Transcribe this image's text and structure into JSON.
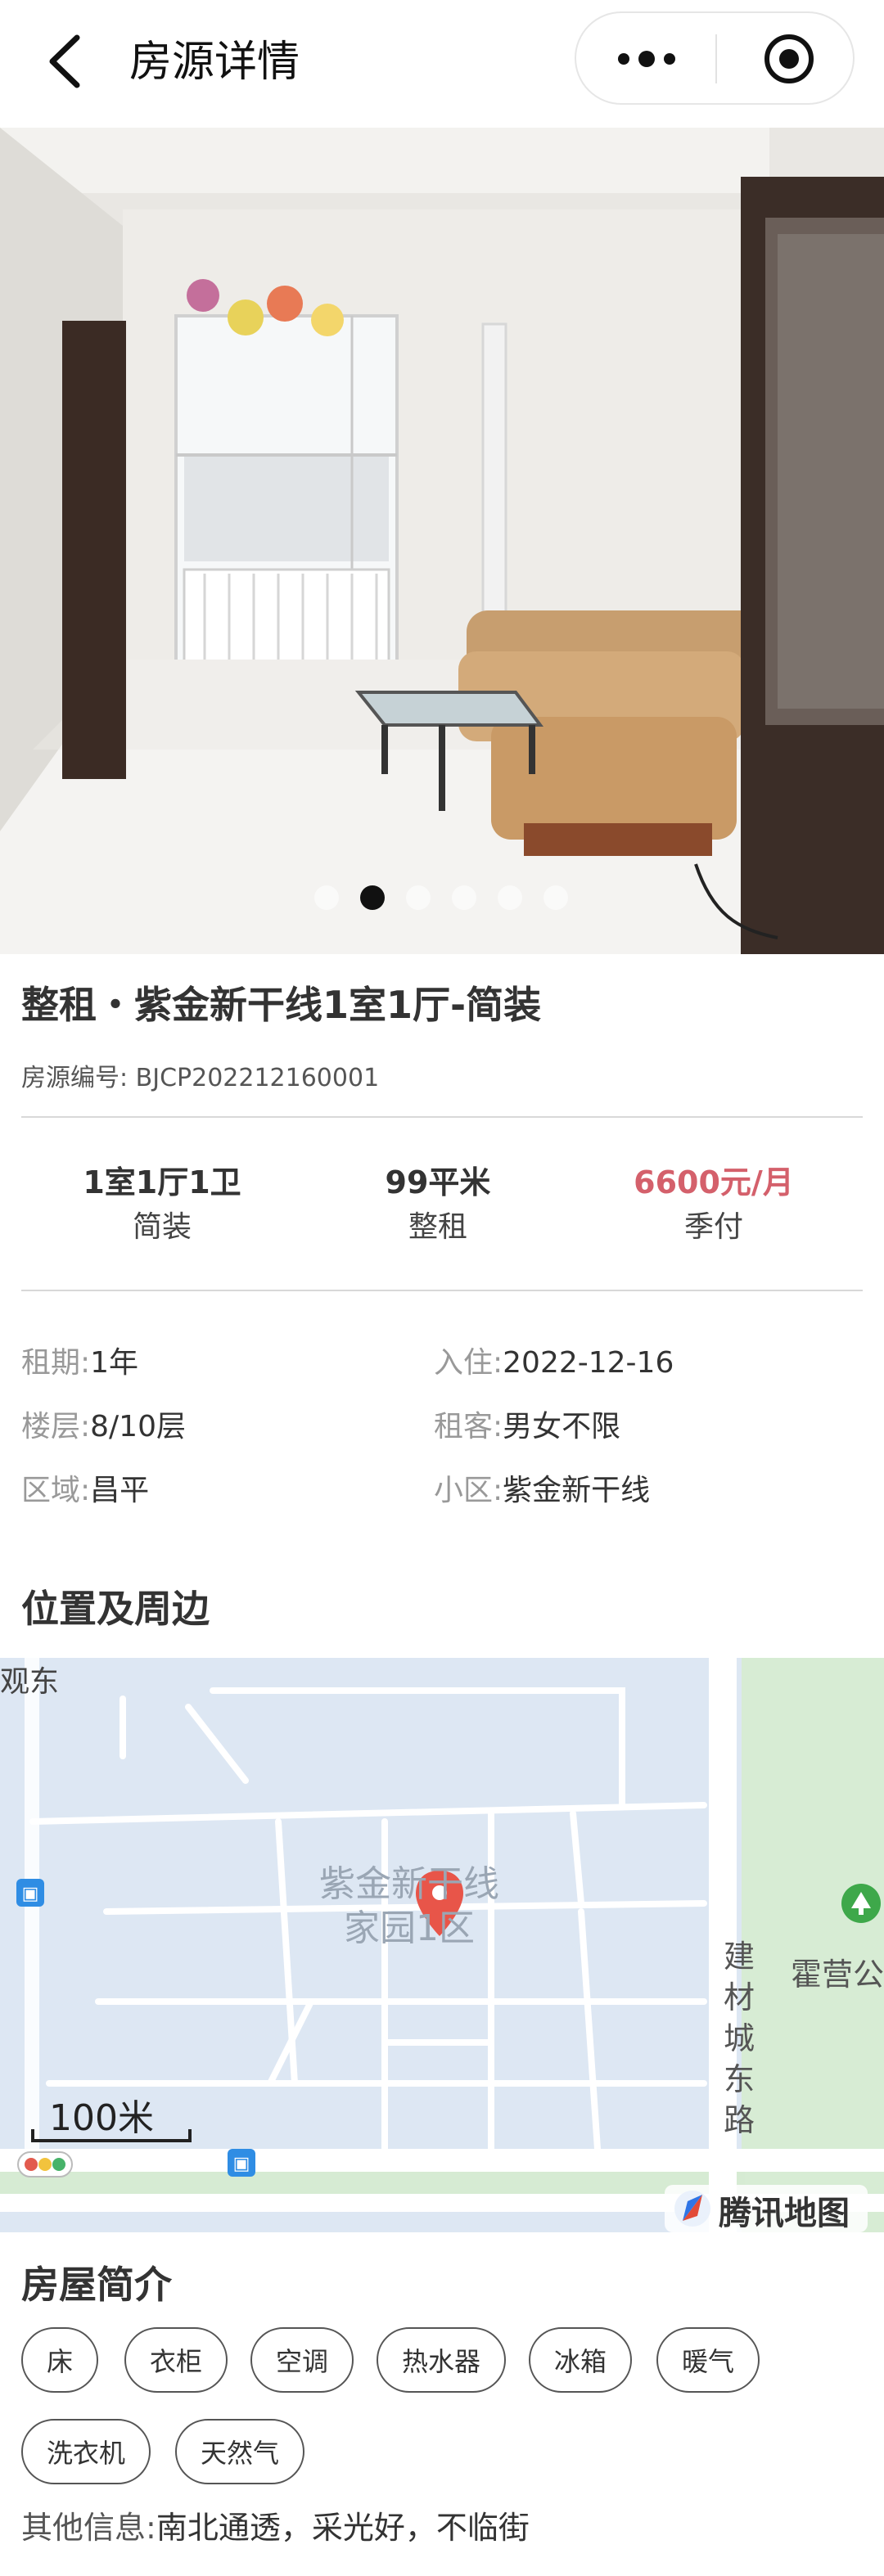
{
  "nav": {
    "title": "房源详情"
  },
  "gallery": {
    "total": 6,
    "active_index": 1
  },
  "listing": {
    "title": "整租・紫金新干线1室1厅-简装",
    "code": "房源编号: BJCP202212160001"
  },
  "stats": [
    {
      "big": "1室1厅1卫",
      "small": "简装"
    },
    {
      "big": "99平米",
      "small": "整租"
    },
    {
      "big": "6600元/月",
      "small": "季付"
    }
  ],
  "info": {
    "lease_label": "租期:",
    "lease_value": "1年",
    "movein_label": "入住:",
    "movein_value": "2022-12-16",
    "floor_label": "楼层:",
    "floor_value": "8/10层",
    "tenant_label": "租客:",
    "tenant_value": "男女不限",
    "area_label": "区域:",
    "area_value": "昌平",
    "community_label": "小区:",
    "community_value": "紫金新干线"
  },
  "location": {
    "title": "位置及周边",
    "map_label_line1": "紫金新干线",
    "map_label_line2": "家园1区",
    "road_label": "建材城东路",
    "place_right": "霍营公",
    "place_left": "观东",
    "scale": "100米",
    "brand": "腾讯地图"
  },
  "intro": {
    "title": "房屋简介",
    "tags": [
      "床",
      "衣柜",
      "空调",
      "热水器",
      "冰箱",
      "暖气",
      "洗衣机",
      "天然气"
    ],
    "other_label": "其他信息:",
    "other_value": "南北通透，采光好，不临街"
  }
}
